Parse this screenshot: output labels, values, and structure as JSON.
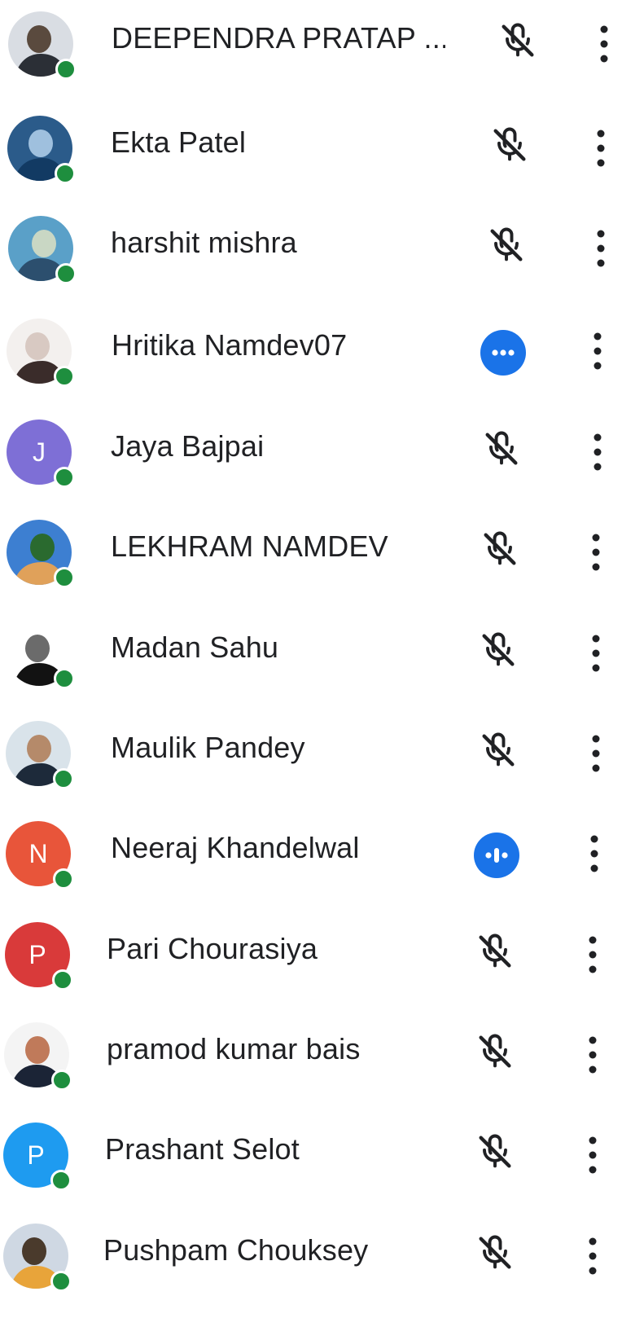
{
  "participants": [
    {
      "name": "DEEPENDRA PRATAP ...",
      "avatar": {
        "kind": "photo",
        "colors": [
          "#d9dde3",
          "#2b2f36",
          "#5a4a3e"
        ]
      },
      "status": "muted"
    },
    {
      "name": "Ekta Patel",
      "avatar": {
        "kind": "photo",
        "colors": [
          "#2b5b8a",
          "#123a63",
          "#9fc0de"
        ]
      },
      "status": "muted"
    },
    {
      "name": "harshit mishra",
      "avatar": {
        "kind": "photo",
        "colors": [
          "#5aa0c8",
          "#2c4f6e",
          "#c9d7c4"
        ]
      },
      "status": "muted"
    },
    {
      "name": "Hritika Namdev07",
      "avatar": {
        "kind": "photo",
        "colors": [
          "#f3f0ee",
          "#3a2c2a",
          "#d8c9c2"
        ]
      },
      "status": "typing"
    },
    {
      "name": "Jaya Bajpai",
      "avatar": {
        "kind": "letter",
        "letter": "J",
        "color": "#7e6fd6"
      },
      "status": "muted"
    },
    {
      "name": "LEKHRAM NAMDEV",
      "avatar": {
        "kind": "photo",
        "colors": [
          "#3d7fd1",
          "#e0a15a",
          "#2a6a2f"
        ]
      },
      "status": "muted"
    },
    {
      "name": "Madan Sahu",
      "avatar": {
        "kind": "photo",
        "colors": [
          "#ffffff",
          "#121212",
          "#6b6b6b"
        ]
      },
      "status": "muted"
    },
    {
      "name": "Maulik Pandey",
      "avatar": {
        "kind": "photo",
        "colors": [
          "#d9e3ea",
          "#1d2a3a",
          "#b58a6a"
        ]
      },
      "status": "muted"
    },
    {
      "name": "Neeraj Khandelwal",
      "avatar": {
        "kind": "letter",
        "letter": "N",
        "color": "#e8553a"
      },
      "status": "speaking"
    },
    {
      "name": "Pari Chourasiya",
      "avatar": {
        "kind": "letter",
        "letter": "P",
        "color": "#d93a3a"
      },
      "status": "muted"
    },
    {
      "name": "pramod kumar bais",
      "avatar": {
        "kind": "photo",
        "colors": [
          "#f4f4f4",
          "#1b2436",
          "#c07a5a"
        ]
      },
      "status": "muted"
    },
    {
      "name": "Prashant Selot",
      "avatar": {
        "kind": "letter",
        "letter": "P",
        "color": "#1e9bf0"
      },
      "status": "muted"
    },
    {
      "name": "Pushpam Chouksey",
      "avatar": {
        "kind": "photo",
        "colors": [
          "#cfd8e3",
          "#e8a43a",
          "#4a3a2c"
        ]
      },
      "status": "muted"
    }
  ],
  "colors": {
    "online": "#1e8e3e",
    "accent": "#1a73e8",
    "icon": "#202124"
  },
  "icons": {
    "muted": "mic-off-icon",
    "typing": "ellipsis-icon",
    "speaking": "audio-level-icon",
    "more": "more-vert-icon"
  }
}
